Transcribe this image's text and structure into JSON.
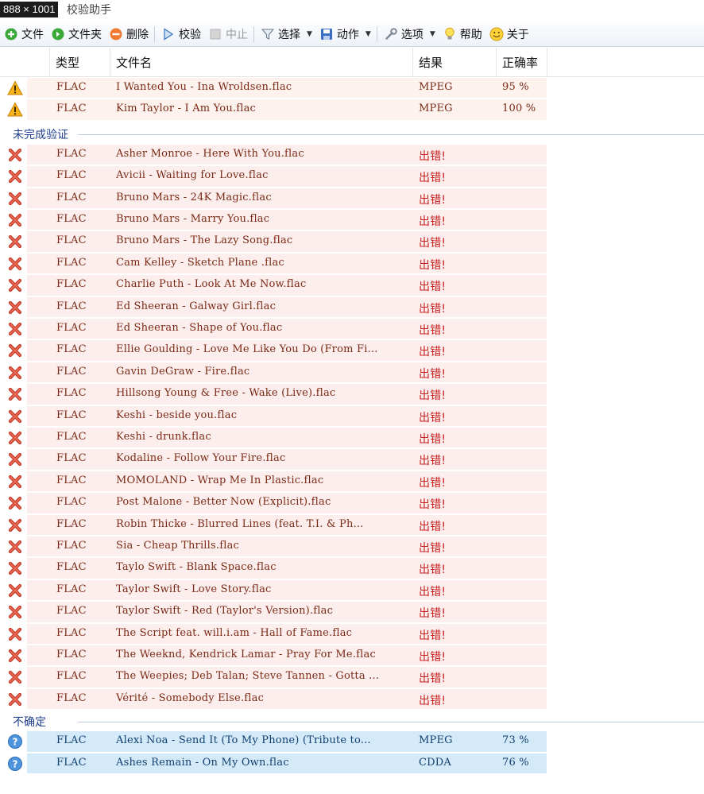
{
  "window": {
    "size_badge": "888 × 1001",
    "title": "校验助手"
  },
  "toolbar": {
    "file": "文件",
    "folder": "文件夹",
    "delete": "删除",
    "verify": "校验",
    "stop": "中止",
    "select": "选择",
    "action": "动作",
    "options": "选项",
    "help": "帮助",
    "about": "关于"
  },
  "columns": {
    "type": "类型",
    "filename": "文件名",
    "result": "结果",
    "accuracy": "正确率"
  },
  "groups": {
    "incomplete": "未完成验证",
    "uncertain": "不确定"
  },
  "colors": {
    "warn_bg": "#fdf2ee",
    "error_bg": "#fdeeee",
    "uncertain_bg": "#d5eaf9",
    "error_text": "#c81e1e",
    "group_text": "#1f3f8f"
  },
  "rows_top": [
    {
      "type": "FLAC",
      "name": "I Wanted You - Ina Wroldsen.flac",
      "result": "MPEG",
      "acc": "95 %"
    },
    {
      "type": "FLAC",
      "name": "Kim Taylor - I Am You.flac",
      "result": "MPEG",
      "acc": "100 %"
    }
  ],
  "rows_error": [
    {
      "type": "FLAC",
      "name": "Asher Monroe - Here With You.flac",
      "result": "出错!"
    },
    {
      "type": "FLAC",
      "name": "Avicii - Waiting for Love.flac",
      "result": "出错!"
    },
    {
      "type": "FLAC",
      "name": "Bruno Mars - 24K Magic.flac",
      "result": "出错!"
    },
    {
      "type": "FLAC",
      "name": "Bruno Mars - Marry You.flac",
      "result": "出错!"
    },
    {
      "type": "FLAC",
      "name": "Bruno Mars - The Lazy Song.flac",
      "result": "出错!"
    },
    {
      "type": "FLAC",
      "name": "Cam Kelley - Sketch Plane .flac",
      "result": "出错!"
    },
    {
      "type": "FLAC",
      "name": "Charlie Puth - Look At Me Now.flac",
      "result": "出错!"
    },
    {
      "type": "FLAC",
      "name": "Ed Sheeran - Galway Girl.flac",
      "result": "出错!"
    },
    {
      "type": "FLAC",
      "name": "Ed Sheeran - Shape of You.flac",
      "result": "出错!"
    },
    {
      "type": "FLAC",
      "name": "Ellie Goulding - Love Me Like You Do (From Fi...",
      "result": "出错!"
    },
    {
      "type": "FLAC",
      "name": "Gavin DeGraw - Fire.flac",
      "result": "出错!"
    },
    {
      "type": "FLAC",
      "name": "Hillsong Young & Free - Wake (Live).flac",
      "result": "出错!"
    },
    {
      "type": "FLAC",
      "name": "Keshi - beside you.flac",
      "result": "出错!"
    },
    {
      "type": "FLAC",
      "name": "Keshi - drunk.flac",
      "result": "出错!"
    },
    {
      "type": "FLAC",
      "name": "Kodaline - Follow Your Fire.flac",
      "result": "出错!"
    },
    {
      "type": "FLAC",
      "name": "MOMOLAND - Wrap Me In Plastic.flac",
      "result": "出错!"
    },
    {
      "type": "FLAC",
      "name": "Post Malone - Better Now (Explicit).flac",
      "result": "出错!"
    },
    {
      "type": "FLAC",
      "name": "Robin Thicke - Blurred Lines (feat. T.I. & Ph...",
      "result": "出错!"
    },
    {
      "type": "FLAC",
      "name": "Sia - Cheap Thrills.flac",
      "result": "出错!"
    },
    {
      "type": "FLAC",
      "name": "Taylo Swift - Blank Space.flac",
      "result": "出错!"
    },
    {
      "type": "FLAC",
      "name": "Taylor Swift - Love Story.flac",
      "result": "出错!"
    },
    {
      "type": "FLAC",
      "name": "Taylor Swift - Red (Taylor's Version).flac",
      "result": "出错!"
    },
    {
      "type": "FLAC",
      "name": "The Script feat. will.i.am - Hall of Fame.flac",
      "result": "出错!"
    },
    {
      "type": "FLAC",
      "name": "The Weeknd, Kendrick Lamar - Pray For Me.flac",
      "result": "出错!"
    },
    {
      "type": "FLAC",
      "name": "The Weepies; Deb Talan; Steve Tannen - Gotta ...",
      "result": "出错!"
    },
    {
      "type": "FLAC",
      "name": "Vérité - Somebody Else.flac",
      "result": "出错!"
    }
  ],
  "rows_uncertain": [
    {
      "type": "FLAC",
      "name": "Alexi Noa - Send It (To My Phone) (Tribute to...",
      "result": "MPEG",
      "acc": "73 %"
    },
    {
      "type": "FLAC",
      "name": "Ashes Remain - On My Own.flac",
      "result": "CDDA",
      "acc": "76 %"
    }
  ]
}
